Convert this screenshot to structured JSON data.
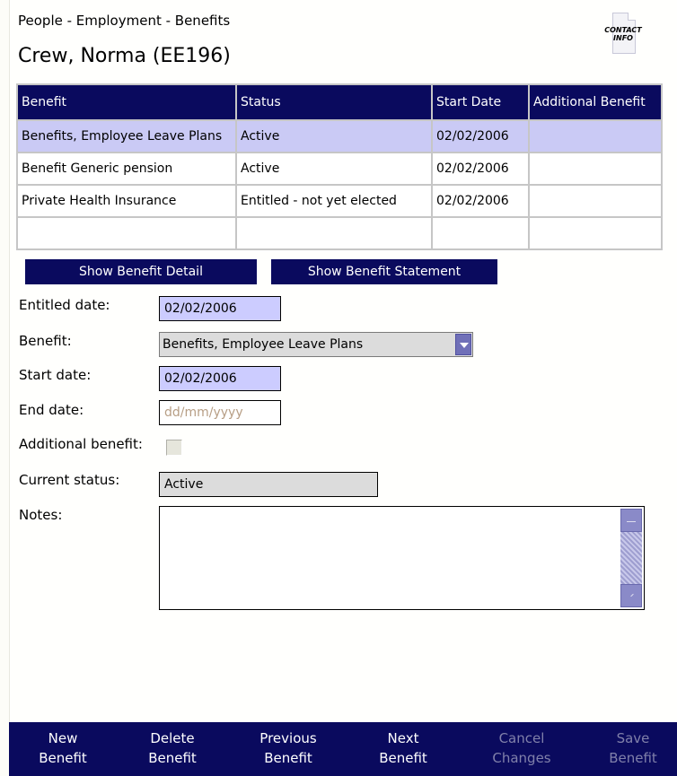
{
  "header": {
    "breadcrumb": "People - Employment - Benefits",
    "title": "Crew, Norma (EE196)",
    "contact_label_1": "CONTACT",
    "contact_label_2": "INFO"
  },
  "table": {
    "columns": [
      "Benefit",
      "Status",
      "Start Date",
      "Additional Benefit"
    ],
    "rows": [
      [
        "Benefits, Employee Leave Plans",
        "Active",
        "02/02/2006",
        ""
      ],
      [
        "Benefit Generic pension",
        "Active",
        "02/02/2006",
        ""
      ],
      [
        "Private Health Insurance",
        "Entitled - not yet elected",
        "02/02/2006",
        ""
      ],
      [
        "",
        "",
        "",
        ""
      ]
    ]
  },
  "buttons": {
    "show_detail": "Show Benefit Detail",
    "show_statement": "Show Benefit Statement"
  },
  "form": {
    "entitled_date_label": "Entitled date:",
    "entitled_date_value": "02/02/2006",
    "benefit_label": "Benefit:",
    "benefit_value": "Benefits, Employee Leave Plans",
    "start_date_label": "Start date:",
    "start_date_value": "02/02/2006",
    "end_date_label": "End date:",
    "end_date_placeholder": "dd/mm/yyyy",
    "additional_benefit_label": "Additional benefit:",
    "current_status_label": "Current status:",
    "current_status_value": "Active",
    "notes_label": "Notes:",
    "notes_value": ""
  },
  "bottom_bar": {
    "new_1": "New",
    "new_2": "Benefit",
    "delete_1": "Delete",
    "delete_2": "Benefit",
    "previous_1": "Previous",
    "previous_2": "Benefit",
    "next_1": "Next",
    "next_2": "Benefit",
    "cancel_1": "Cancel",
    "cancel_2": "Changes",
    "save_1": "Save",
    "save_2": "Benefit"
  },
  "colors": {
    "navy": "#0a0a5e",
    "selected_row": "#cacaf5",
    "input_blue": "#ccccff",
    "disabled_text": "#8080aa"
  }
}
